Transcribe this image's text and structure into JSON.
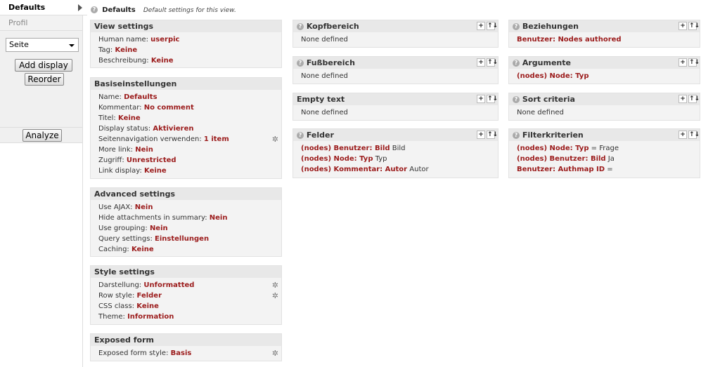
{
  "sidebar": {
    "tabs": [
      {
        "label": "Defaults"
      },
      {
        "label": "Profil"
      }
    ],
    "display_select": "Seite",
    "add_display": "Add display",
    "reorder": "Reorder",
    "analyze": "Analyze"
  },
  "header": {
    "title": "Defaults",
    "description": "Default settings for this view."
  },
  "view_settings": {
    "title": "View settings",
    "rows": [
      {
        "label": "Human name:",
        "value": "userpic"
      },
      {
        "label": "Tag:",
        "value": "Keine"
      },
      {
        "label": "Beschreibung:",
        "value": "Keine"
      }
    ]
  },
  "basis": {
    "title": "Basiseinstellungen",
    "rows": [
      {
        "label": "Name:",
        "value": "Defaults"
      },
      {
        "label": "Kommentar:",
        "value": "No comment"
      },
      {
        "label": "Titel:",
        "value": "Keine"
      },
      {
        "label": "Display status:",
        "value": "Aktivieren"
      },
      {
        "label": "Seitennavigation verwenden:",
        "value": "1 item"
      },
      {
        "label": "More link:",
        "value": "Nein"
      },
      {
        "label": "Zugriff:",
        "value": "Unrestricted"
      },
      {
        "label": "Link display:",
        "value": "Keine"
      }
    ]
  },
  "advanced": {
    "title": "Advanced settings",
    "rows": [
      {
        "label": "Use AJAX:",
        "value": "Nein"
      },
      {
        "label": "Hide attachments in summary:",
        "value": "Nein"
      },
      {
        "label": "Use grouping:",
        "value": "Nein"
      },
      {
        "label": "Query settings:",
        "value": "Einstellungen"
      },
      {
        "label": "Caching:",
        "value": "Keine"
      }
    ]
  },
  "style": {
    "title": "Style settings",
    "rows": [
      {
        "label": "Darstellung:",
        "value": "Unformatted"
      },
      {
        "label": "Row style:",
        "value": "Felder"
      },
      {
        "label": "CSS class:",
        "value": "Keine"
      },
      {
        "label": "Theme:",
        "value": "Information"
      }
    ]
  },
  "exposed": {
    "title": "Exposed form",
    "rows": [
      {
        "label": "Exposed form style:",
        "value": "Basis"
      }
    ]
  },
  "kopf": {
    "title": "Kopfbereich",
    "empty": "None defined"
  },
  "fuss": {
    "title": "Fußbereich",
    "empty": "None defined"
  },
  "empty_text": {
    "title": "Empty text",
    "empty": "None defined"
  },
  "felder": {
    "title": "Felder",
    "rows": [
      {
        "value": "(nodes) Benutzer: Bild",
        "suffix": "Bild"
      },
      {
        "value": "(nodes) Node: Typ",
        "suffix": "Typ"
      },
      {
        "value": "(nodes) Kommentar: Autor",
        "suffix": "Autor"
      }
    ]
  },
  "beziehungen": {
    "title": "Beziehungen",
    "rows": [
      {
        "value": "Benutzer: Nodes authored"
      }
    ]
  },
  "argumente": {
    "title": "Argumente",
    "rows": [
      {
        "value": "(nodes) Node: Typ"
      }
    ]
  },
  "sort": {
    "title": "Sort criteria",
    "empty": "None defined"
  },
  "filter": {
    "title": "Filterkriterien",
    "rows": [
      {
        "value": "(nodes) Node: Typ",
        "suffix": "= Frage"
      },
      {
        "value": "(nodes) Benutzer: Bild",
        "suffix": "Ja"
      },
      {
        "value": "Benutzer: Authmap ID",
        "suffix": "="
      }
    ]
  },
  "controls": {
    "add": "+",
    "rearrange": "↑↓",
    "gear": "✲",
    "help": "?"
  }
}
